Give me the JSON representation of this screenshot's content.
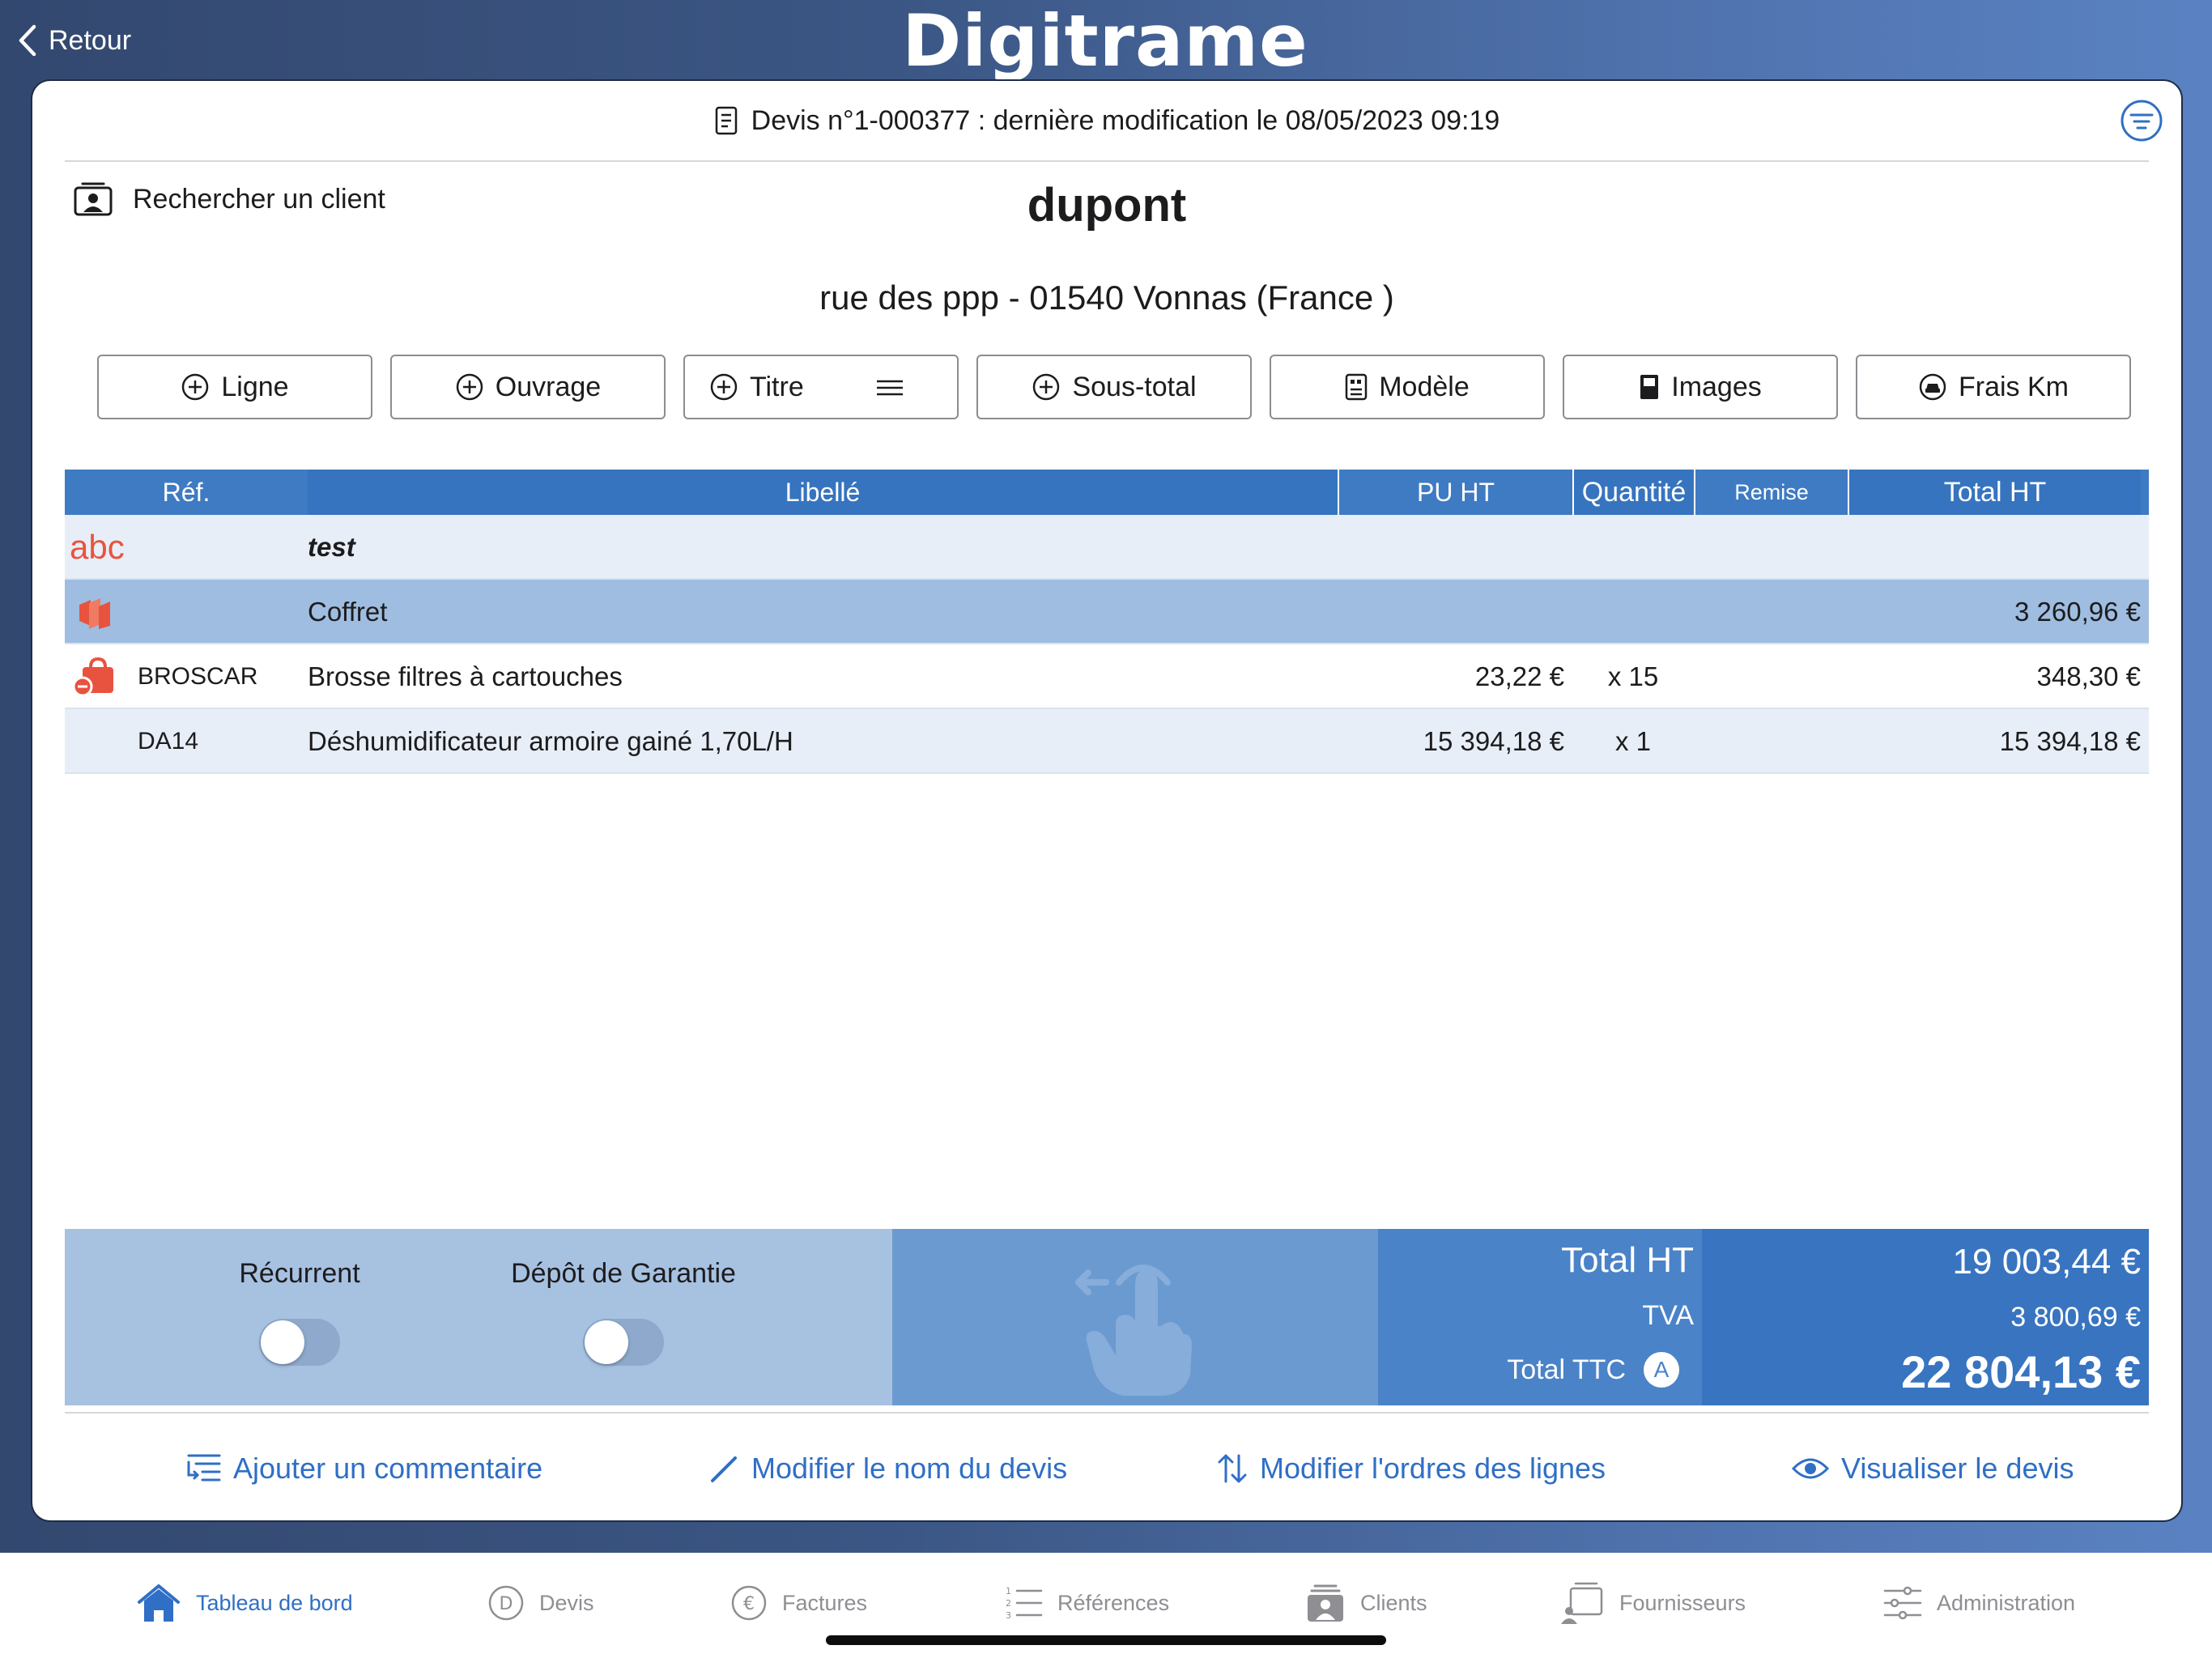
{
  "nav": {
    "back_label": "Retour",
    "brand": "Digitrame"
  },
  "quote": {
    "header": "Devis n°1-000377 : dernière modification le 08/05/2023 09:19"
  },
  "client": {
    "search_label": "Rechercher un client",
    "name": "dupont",
    "address": "rue des ppp - 01540 Vonnas (France )"
  },
  "actions": [
    {
      "label": "Ligne",
      "icon": "plus-circle-icon"
    },
    {
      "label": "Ouvrage",
      "icon": "plus-circle-icon"
    },
    {
      "label": "Titre",
      "icon": "plus-circle-icon"
    },
    {
      "label": "Sous-total",
      "icon": "plus-circle-icon"
    },
    {
      "label": "Modèle",
      "icon": "template-icon"
    },
    {
      "label": "Images",
      "icon": "image-icon"
    },
    {
      "label": "Frais Km",
      "icon": "car-icon"
    }
  ],
  "table": {
    "headers": {
      "ref": "Réf.",
      "label": "Libellé",
      "unit_price": "PU HT",
      "quantity": "Quantité",
      "discount": "Remise",
      "total": "Total HT"
    },
    "rows": [
      {
        "type": "title",
        "marker": "abc",
        "ref": "",
        "label": "test",
        "unit_price": "",
        "quantity": "",
        "total": ""
      },
      {
        "type": "group",
        "icon": "package-stack-icon",
        "ref": "",
        "label": "Coffret",
        "unit_price": "",
        "quantity": "",
        "total": "3 260,96 €"
      },
      {
        "type": "item",
        "icon": "bag-minus-icon",
        "ref": "BROSCAR",
        "label": "Brosse filtres à cartouches",
        "unit_price": "23,22 €",
        "quantity": "x 15",
        "total": "348,30 €"
      },
      {
        "type": "item",
        "icon": "",
        "ref": "DA14",
        "label": "Déshumidificateur armoire gainé 1,70L/H",
        "unit_price": "15 394,18 €",
        "quantity": "x 1",
        "total": "15 394,18 €"
      }
    ]
  },
  "options": {
    "recurring_label": "Récurrent",
    "recurring_on": false,
    "deposit_label": "Dépôt de Garantie",
    "deposit_on": false
  },
  "totals": {
    "ht_label": "Total HT",
    "ht_value": "19 003,44 €",
    "tva_label": "TVA",
    "tva_value": "3 800,69 €",
    "ttc_label": "Total TTC",
    "ttc_badge": "A",
    "ttc_value": "22 804,13 €"
  },
  "links": {
    "comment": "Ajouter un commentaire",
    "rename": "Modifier le nom du devis",
    "reorder": "Modifier l'ordres des lignes",
    "preview": "Visualiser le devis"
  },
  "tabs": [
    {
      "label": "Tableau de bord",
      "active": true
    },
    {
      "label": "Devis",
      "active": false
    },
    {
      "label": "Factures",
      "active": false
    },
    {
      "label": "Références",
      "active": false
    },
    {
      "label": "Clients",
      "active": false
    },
    {
      "label": "Fournisseurs",
      "active": false
    },
    {
      "label": "Administration",
      "active": false
    }
  ],
  "colors": {
    "accent": "#2f6fc6",
    "header_blue": "#3f7bc3",
    "group_row": "#9fbde0",
    "title_row": "#e8eef7",
    "marker_red": "#e8533f"
  }
}
